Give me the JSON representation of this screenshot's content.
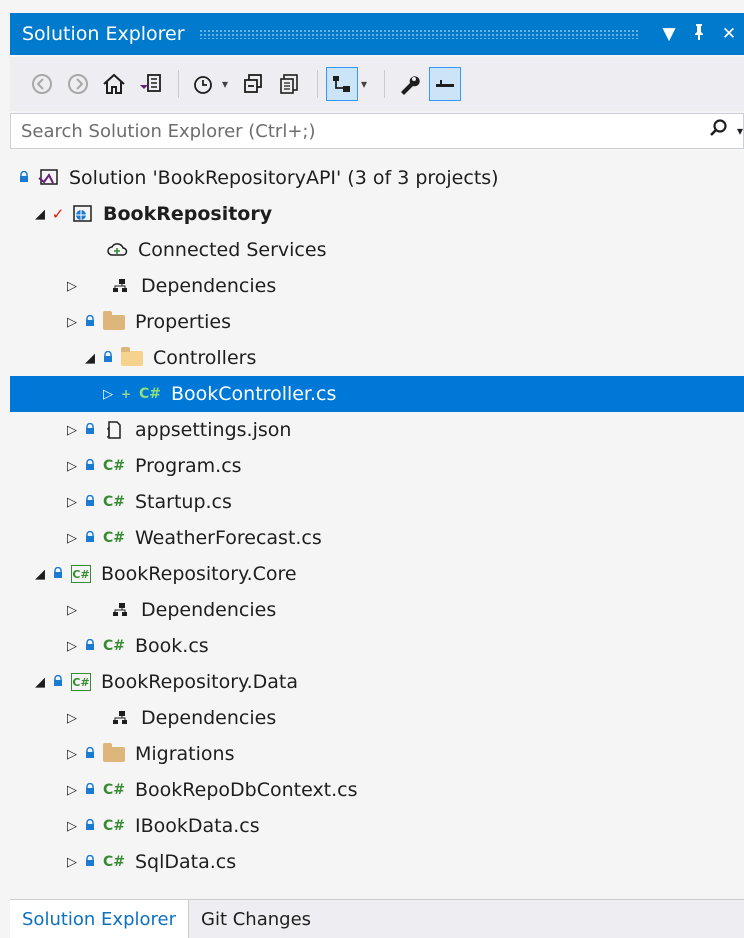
{
  "panel": {
    "title": "Solution Explorer",
    "dropdown_glyph": "▼",
    "pin_glyph": "📌",
    "close_glyph": "✕"
  },
  "toolbar": {
    "back_icon": "◀",
    "forward_icon": "▶",
    "home_icon": "⌂",
    "switch_views_icon": "▤",
    "pending_changes_icon": "⏲",
    "dropdown_arrow": "▾",
    "collapse_all_icon": "⧉",
    "show_all_files_icon": "▣",
    "sync_icon": "⇲",
    "properties_icon": "🔧",
    "preview_icon": "▬"
  },
  "search": {
    "placeholder": "Search Solution Explorer (Ctrl+;)",
    "icon": "⚲"
  },
  "tree": {
    "solution": {
      "label": "Solution 'BookRepositoryAPI' (3 of 3 projects)"
    },
    "book_repository": {
      "label": "BookRepository"
    },
    "connected_services": {
      "label": "Connected Services"
    },
    "dependencies_1": {
      "label": "Dependencies"
    },
    "properties": {
      "label": "Properties"
    },
    "controllers": {
      "label": "Controllers"
    },
    "book_controller": {
      "label": "BookController.cs"
    },
    "appsettings": {
      "label": "appsettings.json"
    },
    "program": {
      "label": "Program.cs"
    },
    "startup": {
      "label": "Startup.cs"
    },
    "weather_forecast": {
      "label": "WeatherForecast.cs"
    },
    "core": {
      "label": "BookRepository.Core"
    },
    "dependencies_2": {
      "label": "Dependencies"
    },
    "book_cs": {
      "label": "Book.cs"
    },
    "data": {
      "label": "BookRepository.Data"
    },
    "dependencies_3": {
      "label": "Dependencies"
    },
    "migrations": {
      "label": "Migrations"
    },
    "db_context": {
      "label": "BookRepoDbContext.cs"
    },
    "ibook_data": {
      "label": "IBookData.cs"
    },
    "sql_data": {
      "label": "SqlData.cs"
    }
  },
  "glyphs": {
    "expanded": "◢",
    "collapsed": "▷",
    "lock": "🔒",
    "check": "✓",
    "plus": "+",
    "cs": "C#"
  },
  "tabs": {
    "solution_explorer": "Solution Explorer",
    "git_changes": "Git Changes"
  },
  "colors": {
    "accent": "#007acc",
    "selection": "#0078d7",
    "csharp_green": "#388a34",
    "folder": "#dcb67a",
    "lock_blue": "#1c7bd1",
    "check_red": "#e51400"
  }
}
